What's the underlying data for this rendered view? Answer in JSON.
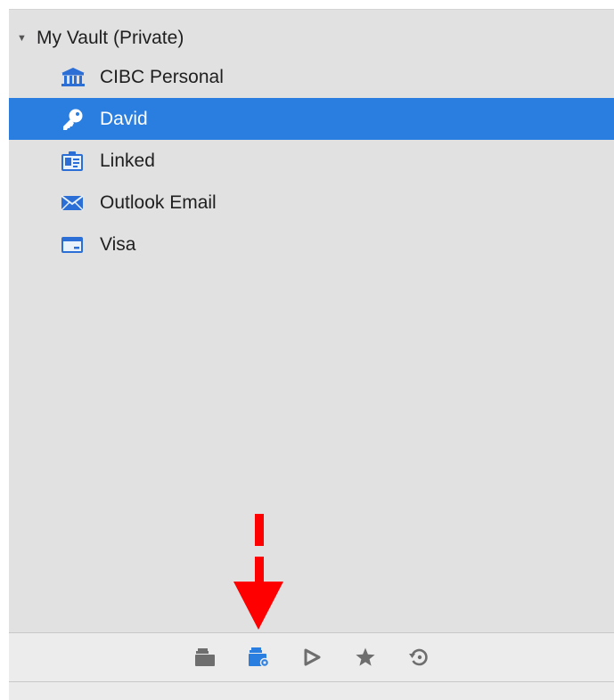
{
  "vault": {
    "title": "My Vault (Private)",
    "disclosure": "▼",
    "items": [
      {
        "label": "CIBC Personal",
        "icon": "bank-icon"
      },
      {
        "label": "David",
        "icon": "key-icon",
        "selected": true
      },
      {
        "label": "Linked",
        "icon": "id-card-icon"
      },
      {
        "label": "Outlook Email",
        "icon": "envelope-icon"
      },
      {
        "label": "Visa",
        "icon": "credit-card-icon"
      }
    ]
  },
  "footer": {
    "buttons": [
      {
        "name": "all-vaults-icon",
        "active": false
      },
      {
        "name": "vault-icon",
        "active": true
      },
      {
        "name": "play-icon",
        "active": false
      },
      {
        "name": "star-icon",
        "active": false
      },
      {
        "name": "history-icon",
        "active": false
      }
    ]
  },
  "colors": {
    "accent": "#2a7ee0",
    "annotation_arrow": "#ff0000",
    "panel_background": "#e2e1e2"
  }
}
